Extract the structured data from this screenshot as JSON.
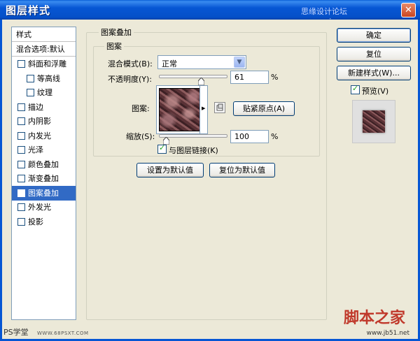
{
  "window": {
    "title": "图层样式",
    "title_watermark": "思缘设计论坛 www.missyuan.com",
    "close_glyph": "✕"
  },
  "stylelist": {
    "header": "样式",
    "blend_options": "混合选项:默认",
    "items": [
      {
        "label": "斜面和浮雕",
        "checked": false,
        "indent": false,
        "selected": false
      },
      {
        "label": "等高线",
        "checked": false,
        "indent": true,
        "selected": false
      },
      {
        "label": "纹理",
        "checked": false,
        "indent": true,
        "selected": false
      },
      {
        "label": "描边",
        "checked": false,
        "indent": false,
        "selected": false
      },
      {
        "label": "内阴影",
        "checked": false,
        "indent": false,
        "selected": false
      },
      {
        "label": "内发光",
        "checked": false,
        "indent": false,
        "selected": false
      },
      {
        "label": "光泽",
        "checked": false,
        "indent": false,
        "selected": false
      },
      {
        "label": "颜色叠加",
        "checked": false,
        "indent": false,
        "selected": false
      },
      {
        "label": "渐变叠加",
        "checked": false,
        "indent": false,
        "selected": false
      },
      {
        "label": "图案叠加",
        "checked": true,
        "indent": false,
        "selected": true
      },
      {
        "label": "外发光",
        "checked": false,
        "indent": false,
        "selected": false
      },
      {
        "label": "投影",
        "checked": false,
        "indent": false,
        "selected": false
      }
    ]
  },
  "panel": {
    "group_title": "图案叠加",
    "sub_title": "图案",
    "blend_mode_label": "混合模式(B):",
    "blend_mode_value": "正常",
    "opacity_label": "不透明度(Y):",
    "opacity_value": "61",
    "opacity_unit": "%",
    "opacity_fraction": 0.61,
    "pattern_label": "图案:",
    "snap_origin_button": "贴紧原点(A)",
    "scale_label": "缩放(S):",
    "scale_value": "100",
    "scale_unit": "%",
    "scale_fraction": 0.1,
    "link_layer_label": "与图层链接(K)",
    "link_layer_checked": true,
    "set_default_button": "设置为默认值",
    "reset_default_button": "复位为默认值"
  },
  "actions": {
    "ok": "确定",
    "reset": "复位",
    "new_style": "新建样式(W)...",
    "preview_label": "预览(V)",
    "preview_checked": true
  },
  "watermarks": {
    "ps_logo": "PS学堂",
    "ps_url": "WWW.68PSXT.COM",
    "site_logo": "脚本之家",
    "site_url": "www.jb51.net"
  },
  "colors": {
    "titlebar": "#0656d4",
    "selection": "#316ac5",
    "check": "#21a121",
    "pattern": "#6b3d40"
  }
}
